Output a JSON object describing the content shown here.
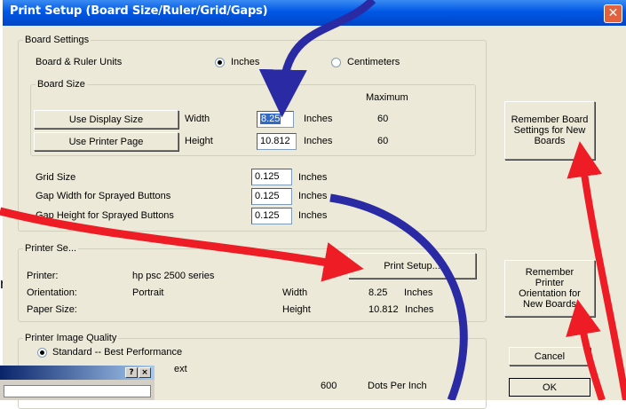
{
  "window": {
    "title": "Print Setup (Board Size/Ruler/Grid/Gaps)",
    "close_glyph": "✕"
  },
  "board_settings": {
    "legend": "Board Settings",
    "units_label": "Board & Ruler Units",
    "units_options": [
      {
        "label": "Inches",
        "selected": true
      },
      {
        "label": "Centimeters",
        "selected": false
      }
    ],
    "board_size": {
      "legend": "Board Size",
      "maximum_header": "Maximum",
      "use_display_size": "Use Display Size",
      "use_printer_page": "Use Printer Page",
      "width_label": "Width",
      "width_value": "8.25",
      "width_unit": "Inches",
      "width_max": "60",
      "height_label": "Height",
      "height_value": "10.812",
      "height_unit": "Inches",
      "height_max": "60"
    },
    "grid_size_label": "Grid Size",
    "grid_size_value": "0.125",
    "grid_size_unit": "Inches",
    "gap_width_label": "Gap Width for Sprayed Buttons",
    "gap_width_value": "0.125",
    "gap_width_unit": "Inches",
    "gap_height_label": "Gap Height for Sprayed Buttons",
    "gap_height_value": "0.125",
    "gap_height_unit": "Inches"
  },
  "printer_settings": {
    "legend": "Printer Se...",
    "print_setup_button": "Print Setup...",
    "printer_label": "Printer:",
    "printer_value": "hp psc 2500 series",
    "orientation_label": "Orientation:",
    "orientation_value": "Portrait",
    "paper_size_label": "Paper Size:",
    "width_label": "Width",
    "width_value": "8.25",
    "width_unit": "Inches",
    "height_label": "Height",
    "height_value": "10.812",
    "height_unit": "Inches"
  },
  "image_quality": {
    "legend": "Printer Image Quality",
    "standard_option": "Standard  --  Best Performance",
    "dpi_value": "600",
    "dpi_unit": "Dots Per Inch",
    "partial_text": "ext"
  },
  "side_buttons": {
    "remember_board": "Remember Board Settings for New Boards",
    "remember_printer": "Remember Printer Orientation for New Boards",
    "cancel": "Cancel",
    "ok": "OK"
  },
  "background_text": "r",
  "mini_window": {
    "help_glyph": "?",
    "close_glyph": "×"
  },
  "colors": {
    "title_blue": "#0058e6",
    "arrow_red": "#ee1c25",
    "arrow_blue": "#2a2aa5",
    "dialog_bg": "#ece9d8"
  },
  "icons": [
    "close-icon",
    "help-icon",
    "radio-selected-icon",
    "radio-unselected-icon"
  ]
}
